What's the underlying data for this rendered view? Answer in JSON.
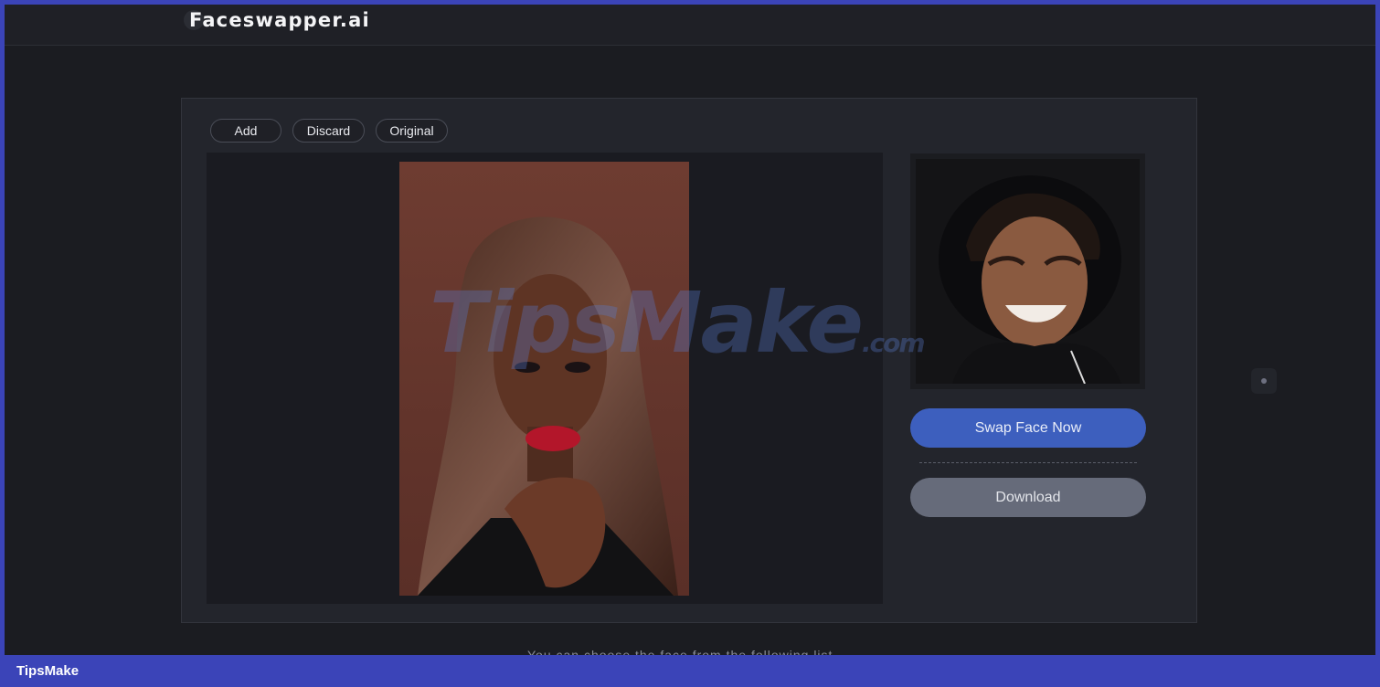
{
  "app": {
    "logo_text": "Faceswapper.ai"
  },
  "toolbar": {
    "add_label": "Add",
    "discard_label": "Discard",
    "original_label": "Original"
  },
  "actions": {
    "swap_label": "Swap Face Now",
    "download_label": "Download"
  },
  "hint_text": "You can choose the face from the following list",
  "watermark": {
    "text": "TipsMake",
    "suffix": ".com"
  },
  "footer": {
    "label": "TipsMake"
  },
  "colors": {
    "accent": "#3d5fbe",
    "download": "#666b7a",
    "background": "#1b1c21",
    "border": "#3b44b8"
  }
}
